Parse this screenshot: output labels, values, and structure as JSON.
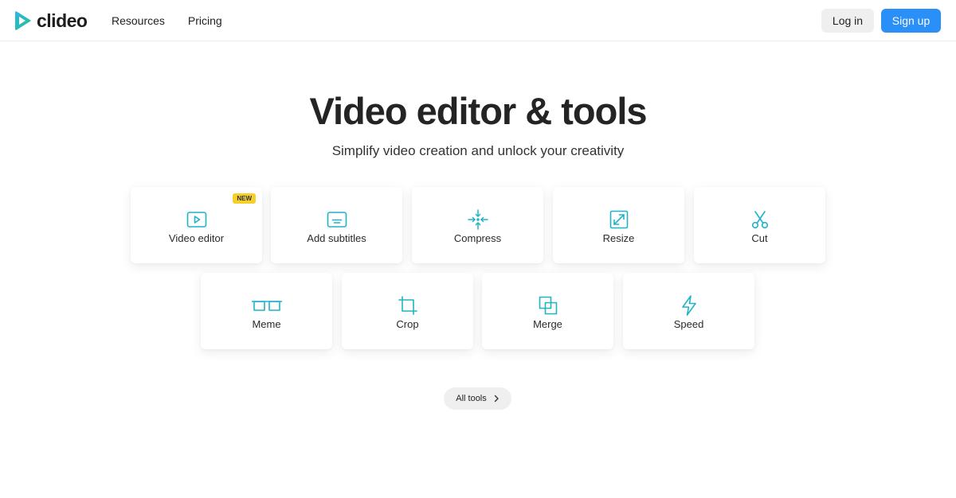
{
  "brand": {
    "name": "clideo"
  },
  "nav": {
    "items": [
      "Resources",
      "Pricing"
    ]
  },
  "auth": {
    "login": "Log in",
    "signup": "Sign up"
  },
  "hero": {
    "title": "Video editor & tools",
    "subtitle": "Simplify video creation and unlock your creativity"
  },
  "tools": [
    {
      "label": "Video editor",
      "icon": "play-icon",
      "badge": "NEW"
    },
    {
      "label": "Add subtitles",
      "icon": "subtitles-icon"
    },
    {
      "label": "Compress",
      "icon": "compress-icon"
    },
    {
      "label": "Resize",
      "icon": "resize-icon"
    },
    {
      "label": "Cut",
      "icon": "scissors-icon"
    },
    {
      "label": "Meme",
      "icon": "meme-icon"
    },
    {
      "label": "Crop",
      "icon": "crop-icon"
    },
    {
      "label": "Merge",
      "icon": "merge-icon"
    },
    {
      "label": "Speed",
      "icon": "lightning-icon"
    }
  ],
  "all_tools": {
    "label": "All tools"
  },
  "colors": {
    "accent": "#1fb3c7",
    "primary": "#2a8ff7",
    "badge": "#f5cf2c"
  }
}
